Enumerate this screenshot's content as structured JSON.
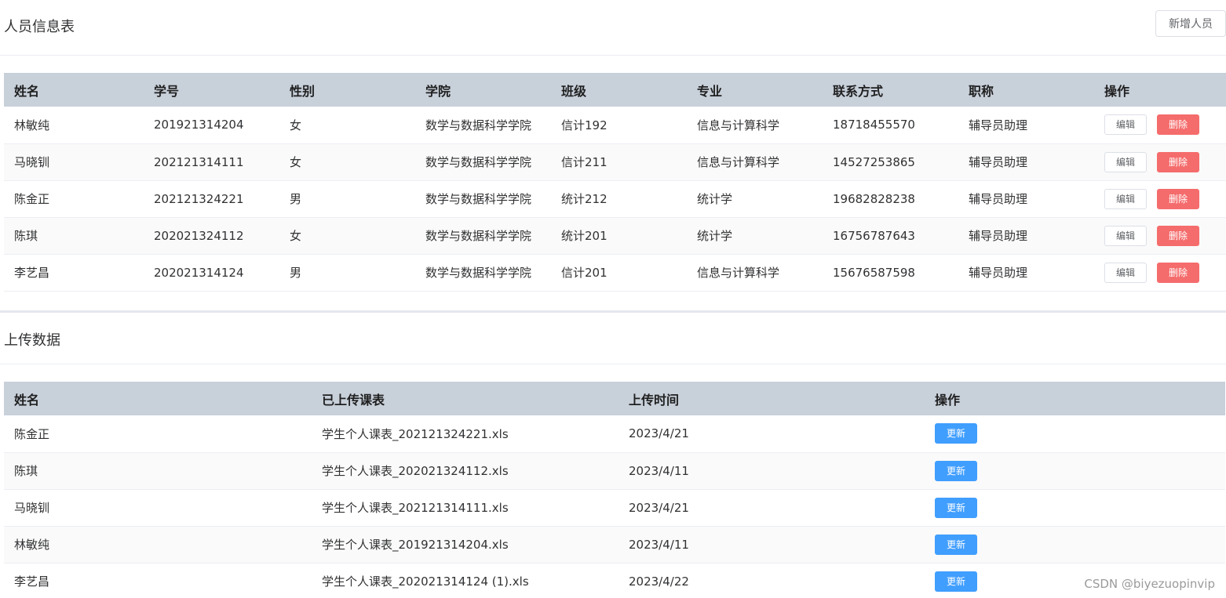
{
  "personnel": {
    "title": "人员信息表",
    "add_button": "新增人员",
    "headers": [
      "姓名",
      "学号",
      "性别",
      "学院",
      "班级",
      "专业",
      "联系方式",
      "职称",
      "操作"
    ],
    "rows": [
      [
        "林敏纯",
        "201921314204",
        "女",
        "数学与数据科学学院",
        "信计192",
        "信息与计算科学",
        "18718455570",
        "辅导员助理"
      ],
      [
        "马晓钏",
        "202121314111",
        "女",
        "数学与数据科学学院",
        "信计211",
        "信息与计算科学",
        "14527253865",
        "辅导员助理"
      ],
      [
        "陈金正",
        "202121324221",
        "男",
        "数学与数据科学学院",
        "统计212",
        "统计学",
        "19682828238",
        "辅导员助理"
      ],
      [
        "陈琪",
        "202021324112",
        "女",
        "数学与数据科学学院",
        "统计201",
        "统计学",
        "16756787643",
        "辅导员助理"
      ],
      [
        "李艺昌",
        "202021314124",
        "男",
        "数学与数据科学学院",
        "信计201",
        "信息与计算科学",
        "15676587598",
        "辅导员助理"
      ]
    ],
    "edit_label": "编辑",
    "delete_label": "删除"
  },
  "upload": {
    "title": "上传数据",
    "headers": [
      "姓名",
      "已上传课表",
      "上传时间",
      "操作"
    ],
    "rows": [
      [
        "陈金正",
        "学生个人课表_202121324221.xls",
        "2023/4/21"
      ],
      [
        "陈琪",
        "学生个人课表_202021324112.xls",
        "2023/4/11"
      ],
      [
        "马晓钏",
        "学生个人课表_202121314111.xls",
        "2023/4/21"
      ],
      [
        "林敏纯",
        "学生个人课表_201921314204.xls",
        "2023/4/11"
      ],
      [
        "李艺昌",
        "学生个人课表_202021314124 (1).xls",
        "2023/4/22"
      ]
    ],
    "update_label": "更新"
  },
  "colors": {
    "header_bg": "#c8d0da",
    "delete": "#f56c6c",
    "update": "#409eff"
  },
  "watermark": "CSDN @biyezuopinvip"
}
